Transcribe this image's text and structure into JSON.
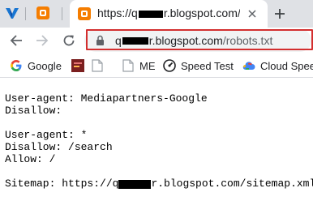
{
  "tabs": {
    "active": {
      "title": "https://q",
      "title_suffix": "r.blogspot.com/ro"
    }
  },
  "address_bar": {
    "url_host_start": "q",
    "url_host_end": "r.blogspot.com",
    "url_path": "/robots.txt",
    "highlight_color": "#d32f2f"
  },
  "bookmarks": [
    {
      "label": "Google",
      "icon": "google-icon"
    },
    {
      "label": "",
      "icon": "tile-icon"
    },
    {
      "label": "",
      "icon": "broken-image-icon"
    },
    {
      "label": "ME",
      "icon": "broken-image-icon"
    },
    {
      "label": "Speed Test",
      "icon": "speedtest-icon"
    },
    {
      "label": "Cloud Speech",
      "icon": "cloud-icon"
    }
  ],
  "document": {
    "lines": [
      "User-agent: Mediapartners-Google",
      "Disallow:",
      "",
      "User-agent: *",
      "Disallow: /search",
      "Allow: /",
      ""
    ],
    "sitemap_prefix": "Sitemap: https://q",
    "sitemap_suffix": "r.blogspot.com/sitemap.xml"
  },
  "colors": {
    "tabstrip": "#dfe1e5",
    "blogger_orange": "#f57d00",
    "omnibox": "#f1f3f4"
  }
}
